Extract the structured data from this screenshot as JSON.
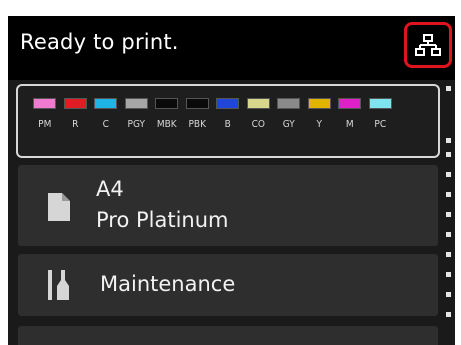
{
  "status": {
    "text": "Ready to print."
  },
  "header": {
    "network_icon": "network-icon",
    "highlight_color": "#e0141e"
  },
  "inks": [
    {
      "label": "PM",
      "color": "#f07ad0"
    },
    {
      "label": "R",
      "color": "#e01c24"
    },
    {
      "label": "C",
      "color": "#1eb4e6"
    },
    {
      "label": "PGY",
      "color": "#a6a6a6"
    },
    {
      "label": "MBK",
      "color": "#0a0a0a"
    },
    {
      "label": "PBK",
      "color": "#0a0a0a"
    },
    {
      "label": "B",
      "color": "#1f46d6"
    },
    {
      "label": "CO",
      "color": "#d8d88c"
    },
    {
      "label": "GY",
      "color": "#8a8a8a"
    },
    {
      "label": "Y",
      "color": "#e0b400"
    },
    {
      "label": "M",
      "color": "#e020c8"
    },
    {
      "label": "PC",
      "color": "#7ee4f0"
    }
  ],
  "paper": {
    "size": "A4",
    "type": "Pro Platinum",
    "icon": "paper-sheet-icon"
  },
  "maintenance": {
    "label": "Maintenance",
    "icon": "maintenance-tools-icon"
  }
}
